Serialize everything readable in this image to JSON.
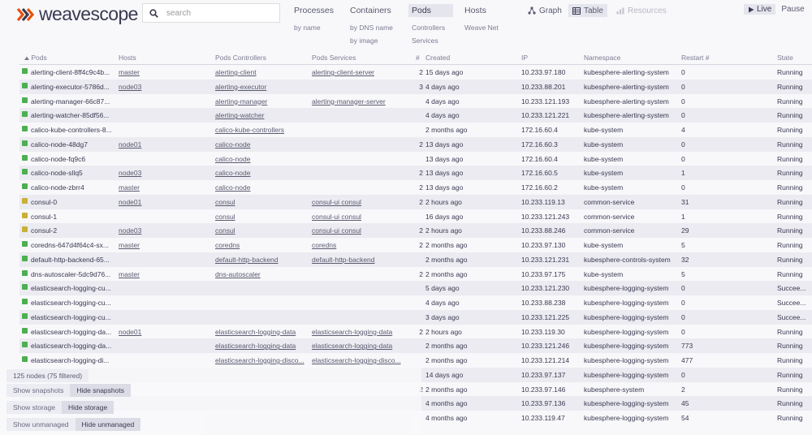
{
  "app": {
    "brand": "weavescope",
    "brand_color": "#e8500a"
  },
  "search": {
    "placeholder": "search"
  },
  "topologies": [
    {
      "label": "Processes",
      "subs": [
        "by name"
      ]
    },
    {
      "label": "Containers",
      "subs": [
        "by DNS name",
        "by image"
      ]
    },
    {
      "label": "Pods",
      "subs": [
        "Controllers",
        "Services"
      ],
      "selected": true
    },
    {
      "label": "Hosts",
      "subs": [
        "Weave Net"
      ]
    }
  ],
  "views": {
    "graph": "Graph",
    "table": "Table",
    "resources": "Resources"
  },
  "controls": {
    "live": "Live",
    "pause": "Pause"
  },
  "table": {
    "columns": [
      "Pods",
      "Hosts",
      "Pods Controllers",
      "Pods Services",
      "#",
      "Created",
      "IP",
      "Namespace",
      "Restart #",
      "State"
    ],
    "rows": [
      {
        "color": "#4caf50",
        "name": "alerting-client-8ff4c9c4b...",
        "host": "master",
        "controller": "alerting-client",
        "service": "alerting-client-server",
        "count": "2",
        "created": "15 days ago",
        "ip": "10.233.97.180",
        "ns": "kubesphere-alerting-system",
        "restart": "0",
        "state": "Running"
      },
      {
        "color": "#4caf50",
        "name": "alerting-executor-5786d...",
        "host": "node03",
        "controller": "alerting-executor",
        "service": "",
        "count": "3",
        "created": "4 days ago",
        "ip": "10.233.88.201",
        "ns": "kubesphere-alerting-system",
        "restart": "0",
        "state": "Running"
      },
      {
        "color": "#4caf50",
        "name": "alerting-manager-66c87...",
        "host": "",
        "controller": "alerting-manager",
        "service": "alerting-manager-server",
        "count": "",
        "created": "4 days ago",
        "ip": "10.233.121.193",
        "ns": "kubesphere-alerting-system",
        "restart": "0",
        "state": "Running"
      },
      {
        "color": "#4caf50",
        "name": "alerting-watcher-85df56...",
        "host": "",
        "controller": "alerting-watcher",
        "service": "",
        "count": "",
        "created": "4 days ago",
        "ip": "10.233.121.221",
        "ns": "kubesphere-alerting-system",
        "restart": "0",
        "state": "Running"
      },
      {
        "color": "#4caf50",
        "name": "calico-kube-controllers-8...",
        "host": "",
        "controller": "calico-kube-controllers",
        "service": "",
        "count": "",
        "created": "2 months ago",
        "ip": "172.16.60.4",
        "ns": "kube-system",
        "restart": "4",
        "state": "Running"
      },
      {
        "color": "#4caf50",
        "name": "calico-node-48dg7",
        "host": "node01",
        "controller": "calico-node",
        "service": "",
        "count": "2",
        "created": "13 days ago",
        "ip": "172.16.60.3",
        "ns": "kube-system",
        "restart": "0",
        "state": "Running"
      },
      {
        "color": "#4caf50",
        "name": "calico-node-fq9c6",
        "host": "",
        "controller": "calico-node",
        "service": "",
        "count": "",
        "created": "13 days ago",
        "ip": "172.16.60.4",
        "ns": "kube-system",
        "restart": "0",
        "state": "Running"
      },
      {
        "color": "#4caf50",
        "name": "calico-node-sllq5",
        "host": "node03",
        "controller": "calico-node",
        "service": "",
        "count": "2",
        "created": "13 days ago",
        "ip": "172.16.60.5",
        "ns": "kube-system",
        "restart": "1",
        "state": "Running"
      },
      {
        "color": "#4caf50",
        "name": "calico-node-zbrr4",
        "host": "master",
        "controller": "calico-node",
        "service": "",
        "count": "2",
        "created": "13 days ago",
        "ip": "172.16.60.2",
        "ns": "kube-system",
        "restart": "0",
        "state": "Running"
      },
      {
        "color": "#c9b037",
        "name": "consul-0",
        "host": "node01",
        "controller": "consul",
        "service": "consul-ui consul",
        "count": "2",
        "created": "2 hours ago",
        "ip": "10.233.119.13",
        "ns": "common-service",
        "restart": "31",
        "state": "Running"
      },
      {
        "color": "#c9b037",
        "name": "consul-1",
        "host": "",
        "controller": "consul",
        "service": "consul-ui consul",
        "count": "",
        "created": "16 days ago",
        "ip": "10.233.121.243",
        "ns": "common-service",
        "restart": "1",
        "state": "Running"
      },
      {
        "color": "#c9b037",
        "name": "consul-2",
        "host": "node03",
        "controller": "consul",
        "service": "consul-ui consul",
        "count": "2",
        "created": "2 hours ago",
        "ip": "10.233.88.246",
        "ns": "common-service",
        "restart": "29",
        "state": "Running"
      },
      {
        "color": "#4caf50",
        "name": "coredns-647d4f64c4-sx...",
        "host": "master",
        "controller": "coredns",
        "service": "coredns",
        "count": "2",
        "created": "2 months ago",
        "ip": "10.233.97.130",
        "ns": "kube-system",
        "restart": "5",
        "state": "Running"
      },
      {
        "color": "#4caf50",
        "name": "default-http-backend-65...",
        "host": "",
        "controller": "default-http-backend",
        "service": "default-http-backend",
        "count": "",
        "created": "2 months ago",
        "ip": "10.233.121.231",
        "ns": "kubesphere-controls-system",
        "restart": "32",
        "state": "Running"
      },
      {
        "color": "#4caf50",
        "name": "dns-autoscaler-5dc9d76...",
        "host": "master",
        "controller": "dns-autoscaler",
        "service": "",
        "count": "2",
        "created": "2 months ago",
        "ip": "10.233.97.175",
        "ns": "kube-system",
        "restart": "5",
        "state": "Running"
      },
      {
        "color": "#4caf50",
        "name": "elasticsearch-logging-cu...",
        "host": "",
        "controller": "",
        "service": "",
        "count": "",
        "created": "5 days ago",
        "ip": "10.233.121.230",
        "ns": "kubesphere-logging-system",
        "restart": "0",
        "state": "Succee..."
      },
      {
        "color": "#4caf50",
        "name": "elasticsearch-logging-cu...",
        "host": "",
        "controller": "",
        "service": "",
        "count": "",
        "created": "4 days ago",
        "ip": "10.233.88.238",
        "ns": "kubesphere-logging-system",
        "restart": "0",
        "state": "Succee..."
      },
      {
        "color": "#4caf50",
        "name": "elasticsearch-logging-cu...",
        "host": "",
        "controller": "",
        "service": "",
        "count": "",
        "created": "3 days ago",
        "ip": "10.233.121.225",
        "ns": "kubesphere-logging-system",
        "restart": "0",
        "state": "Succee..."
      },
      {
        "color": "#4caf50",
        "name": "elasticsearch-logging-da...",
        "host": "node01",
        "controller": "elasticsearch-logging-data",
        "service": "elasticsearch-logging-data",
        "count": "2",
        "created": "2 hours ago",
        "ip": "10.233.119.30",
        "ns": "kubesphere-logging-system",
        "restart": "0",
        "state": "Running"
      },
      {
        "color": "#4caf50",
        "name": "elasticsearch-logging-da...",
        "host": "",
        "controller": "elasticsearch-logging-data",
        "service": "elasticsearch-logging-data",
        "count": "",
        "created": "2 months ago",
        "ip": "10.233.121.246",
        "ns": "kubesphere-logging-system",
        "restart": "773",
        "state": "Running"
      },
      {
        "color": "#4caf50",
        "name": "elasticsearch-logging-di...",
        "host": "",
        "controller": "elasticsearch-logging-disco...",
        "service": "elasticsearch-logging-disco...",
        "count": "",
        "created": "2 months ago",
        "ip": "10.233.121.214",
        "ns": "kubesphere-logging-system",
        "restart": "477",
        "state": "Running"
      },
      {
        "color": "",
        "name": "",
        "host": "",
        "controller": "",
        "service": "",
        "count": "",
        "created": "14 days ago",
        "ip": "10.233.97.137",
        "ns": "kubesphere-logging-system",
        "restart": "0",
        "state": "Running"
      },
      {
        "color": "",
        "name": "",
        "host": "",
        "controller": "",
        "service": "",
        "count": "2",
        "created": "2 months ago",
        "ip": "10.233.97.146",
        "ns": "kubesphere-system",
        "restart": "2",
        "state": "Running"
      },
      {
        "color": "",
        "name": "",
        "host": "",
        "controller": "",
        "service": "",
        "count": "",
        "created": "4 months ago",
        "ip": "10.233.97.136",
        "ns": "kubesphere-logging-system",
        "restart": "45",
        "state": "Running"
      },
      {
        "color": "",
        "name": "",
        "host": "",
        "controller": "",
        "service": "",
        "count": "",
        "created": "4 months ago",
        "ip": "10.233.119.47",
        "ns": "kubesphere-logging-system",
        "restart": "54",
        "state": "Running"
      }
    ]
  },
  "status": {
    "nodes": "125 nodes (75 filtered)"
  },
  "toggles": [
    {
      "off": "Show snapshots",
      "on": "Hide snapshots"
    },
    {
      "off": "Show storage",
      "on": "Hide storage"
    },
    {
      "off": "Show unmanaged",
      "on": "Hide unmanaged"
    }
  ]
}
